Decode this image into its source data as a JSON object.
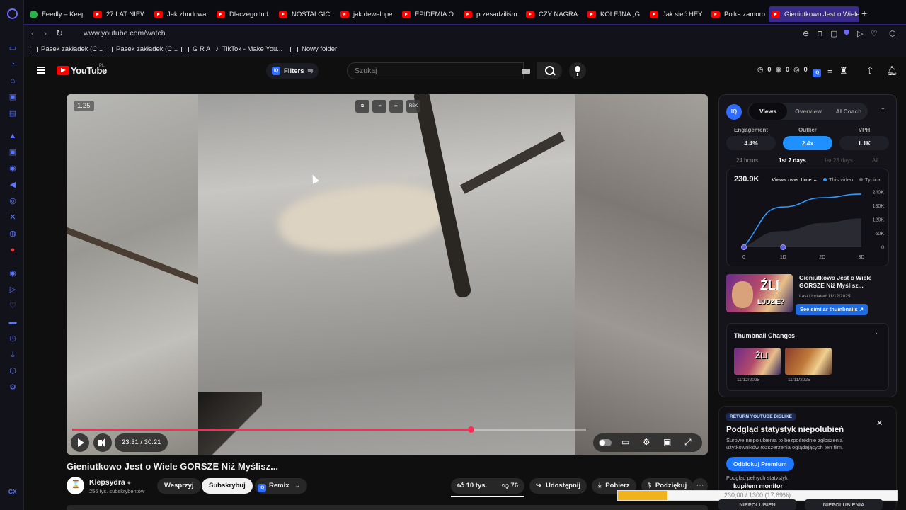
{
  "browser": {
    "tabs": [
      {
        "label": "Feedly – Keep",
        "icon": "feedly-icon"
      },
      {
        "label": "27 LAT NIEW",
        "icon": "youtube-icon"
      },
      {
        "label": "Jak zbudowa",
        "icon": "youtube-icon"
      },
      {
        "label": "Dlaczego ludz",
        "icon": "youtube-icon"
      },
      {
        "label": "NOSTALGICZ",
        "icon": "youtube-icon"
      },
      {
        "label": "jak deweloper",
        "icon": "youtube-icon"
      },
      {
        "label": "EPIDEMIA OT",
        "icon": "youtube-icon"
      },
      {
        "label": "przesadziliśm",
        "icon": "youtube-icon"
      },
      {
        "label": "CZY NAGRAŁ",
        "icon": "youtube-icon"
      },
      {
        "label": "KOLEJNA „GY",
        "icon": "youtube-icon"
      },
      {
        "label": "Jak sieć HEY",
        "icon": "youtube-icon"
      },
      {
        "label": "Polka zamoro",
        "icon": "youtube-icon"
      },
      {
        "label": "Gieniutkowo Jest o Wiele",
        "icon": "youtube-icon",
        "active": true
      }
    ],
    "url": "www.youtube.com/watch",
    "bookmarks": [
      {
        "label": "Pasek zakładek (C...",
        "icon": "folder-icon"
      },
      {
        "label": "Pasek zakładek (C...",
        "icon": "folder-icon"
      },
      {
        "label": "G R A",
        "icon": "folder-icon"
      },
      {
        "label": "TikTok - Make You...",
        "icon": "tiktok-icon"
      },
      {
        "label": "Nowy folder",
        "icon": "folder-icon"
      }
    ],
    "accent": "#3a2a8a"
  },
  "header": {
    "logo_text": "YouTube",
    "logo_region": "PL",
    "filters_label": "Filters",
    "search_placeholder": "Szukaj",
    "counters": [
      "0",
      "0",
      "0"
    ]
  },
  "player": {
    "speed": "1.25",
    "time": "23:31 / 30:21",
    "progress": 0.775,
    "buffered": 0.79,
    "top_controls": [
      "",
      "",
      "",
      "RSK"
    ]
  },
  "video": {
    "title": "Gieniutkowo Jest o Wiele GORSZE Niż Myślisz...",
    "channel": "Klepsydra",
    "subscribers": "256 tys. subskrybentów",
    "support_label": "Wesprzyj",
    "subscribe_label": "Subskrybuj",
    "remix_label": "Remix",
    "likes": "10 tys.",
    "dislikes": "76",
    "share_label": "Udostępnij",
    "download_label": "Pobierz",
    "thanks_label": "Podziękuj"
  },
  "vidiq": {
    "logo": "IQ",
    "tabs": [
      "Views",
      "Overview",
      "AI Coach"
    ],
    "metrics": [
      {
        "label": "Engagement",
        "value": "4.4%"
      },
      {
        "label": "Outlier",
        "value": "2.4x"
      },
      {
        "label": "VPH",
        "value": "1.1K"
      }
    ],
    "ranges": [
      "24 hours",
      "1st 7 days",
      "1st 28 days",
      "All"
    ],
    "views_total": "230.9K",
    "views_selector": "Views over time",
    "legend": [
      "This video",
      "Typical"
    ],
    "thumb_title": "Gieniutkowo Jest o Wiele GORSZE Niż Myślisz...",
    "thumb_updated": "Last Updated 11/12/2025",
    "thumb_button": "See similar thumbnails",
    "thumb_text": "ŹLI",
    "thumb_sub": "LUDZIE?",
    "changes_title": "Thumbnail Changes",
    "changes": [
      {
        "date": "11/12/2025",
        "text": "ŹLI"
      },
      {
        "date": "11/11/2025",
        "text": ""
      }
    ]
  },
  "chart_data": {
    "type": "area",
    "x": [
      "0",
      "1D",
      "2D",
      "3D"
    ],
    "series": [
      {
        "name": "This video",
        "values": [
          0,
          175000,
          215000,
          230900
        ],
        "color": "#2f9bff"
      },
      {
        "name": "Typical",
        "values": [
          0,
          70000,
          105000,
          125000
        ],
        "color": "#555560"
      }
    ],
    "yticks": [
      "0",
      "60K",
      "120K",
      "180K",
      "240K"
    ],
    "ylim": [
      0,
      240000
    ],
    "legend": "top-right",
    "grid": false
  },
  "ryd": {
    "tag": "RETURN YOUTUBE DISLIKE",
    "title": "Podgląd statystyk niepolubień",
    "desc": "Surowe niepolubienia to bezpośrednie zgłoszenia użytkowników rozszerzenia oglądających ten film.",
    "button": "Odblokuj Premium",
    "stats_label": "Podgląd pełnych statystyk",
    "monitor": "kupiłem monitor",
    "bar_text": "230,00 / 1300 (17.69%)",
    "bar_fill": 0.1769,
    "labels": [
      "NIEPOLUBIEN",
      "NIEPOLUBIENIA"
    ]
  }
}
